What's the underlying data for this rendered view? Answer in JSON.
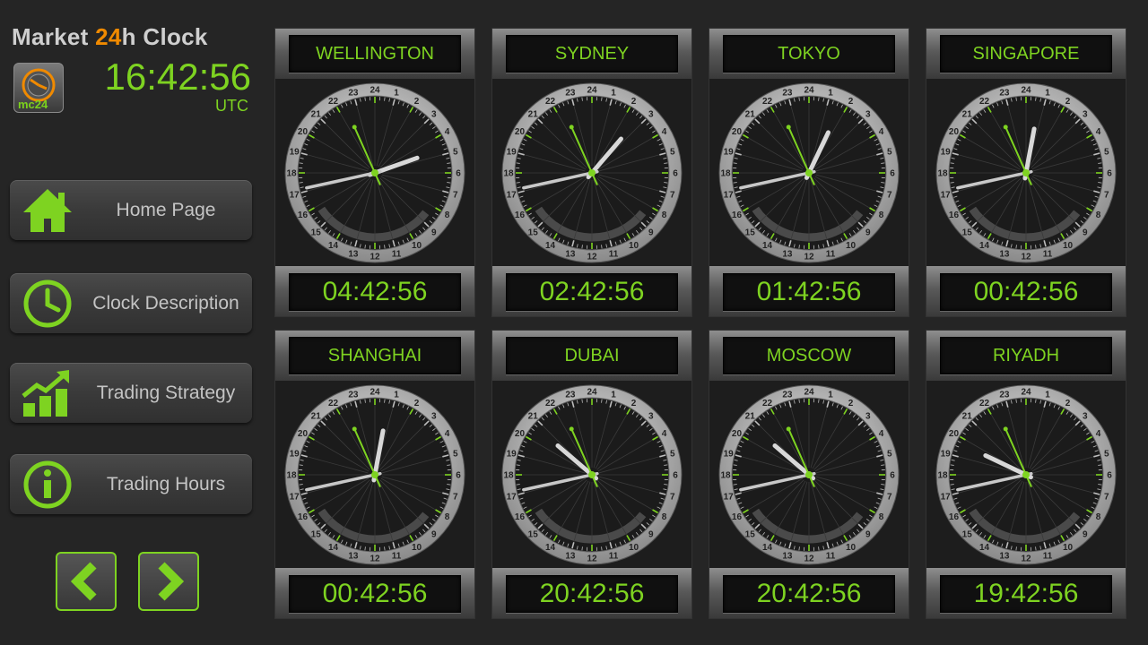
{
  "header": {
    "title_part1": "Market ",
    "title_accent": "24",
    "title_part2": "h Clock",
    "logo_text": "mc24",
    "utc_time": "16:42:56",
    "utc_label": "UTC"
  },
  "nav": [
    {
      "label": "Home Page",
      "icon": "home-icon"
    },
    {
      "label": "Clock Description",
      "icon": "clock-icon"
    },
    {
      "label": "Trading Strategy",
      "icon": "chart-up-icon"
    },
    {
      "label": "Trading Hours",
      "icon": "info-icon"
    }
  ],
  "pager": {
    "prev_icon": "chevron-left-icon",
    "next_icon": "chevron-right-icon"
  },
  "colors": {
    "accent": "#7ed321",
    "brand_orange": "#f08a00",
    "background": "#252525"
  },
  "clocks": [
    {
      "city": "WELLINGTON",
      "time": "04:42:56"
    },
    {
      "city": "SYDNEY",
      "time": "02:42:56"
    },
    {
      "city": "TOKYO",
      "time": "01:42:56"
    },
    {
      "city": "SINGAPORE",
      "time": "00:42:56"
    },
    {
      "city": "SHANGHAI",
      "time": "00:42:56"
    },
    {
      "city": "DUBAI",
      "time": "20:42:56"
    },
    {
      "city": "MOSCOW",
      "time": "20:42:56"
    },
    {
      "city": "RIYADH",
      "time": "19:42:56"
    }
  ],
  "dial_numbers": [
    "24",
    "1",
    "2",
    "3",
    "4",
    "5",
    "6",
    "7",
    "8",
    "9",
    "10",
    "11",
    "12",
    "13",
    "14",
    "15",
    "16",
    "17",
    "18",
    "19",
    "20",
    "21",
    "22",
    "23"
  ]
}
